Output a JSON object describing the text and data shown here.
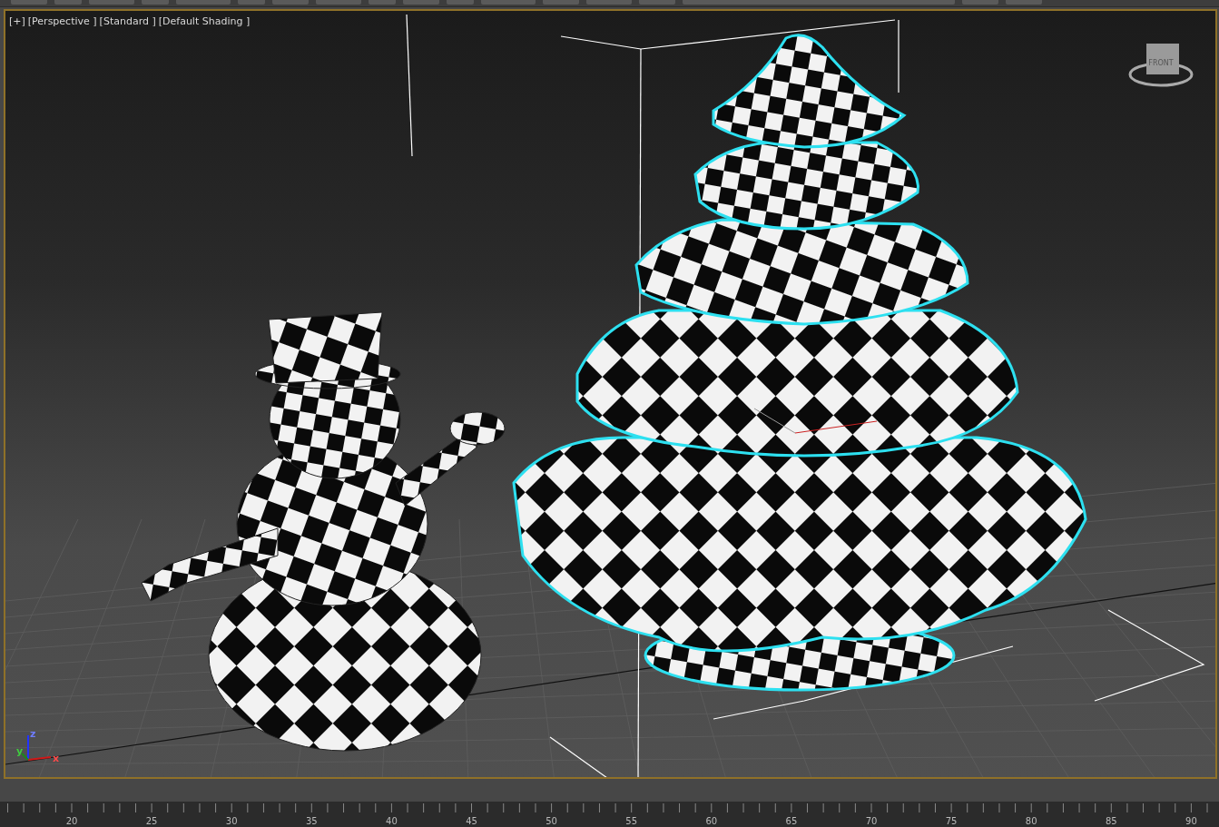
{
  "viewport": {
    "labels": [
      "[+]",
      "[Perspective ]",
      "[Standard ]",
      "[Default Shading ]"
    ],
    "view_cube": {
      "face": "FRONT"
    },
    "axis_tripod": {
      "x": "x",
      "y": "y",
      "z": "z"
    },
    "active": true
  },
  "timeline": {
    "ticks": [
      "20",
      "25",
      "30",
      "35",
      "40",
      "45",
      "50",
      "55",
      "60",
      "65",
      "70",
      "75",
      "80",
      "85",
      "90"
    ]
  }
}
